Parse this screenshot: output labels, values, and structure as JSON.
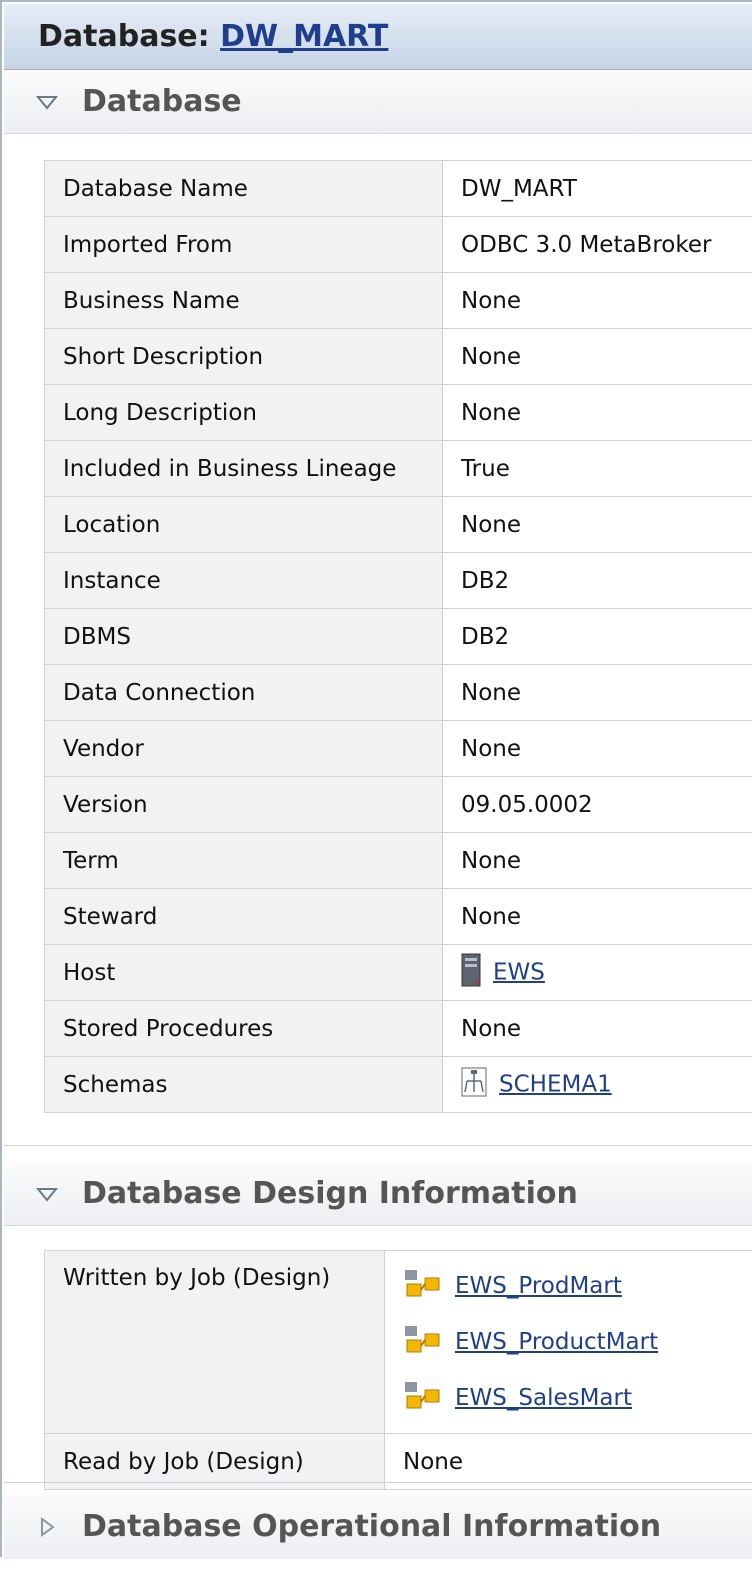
{
  "header": {
    "prefix": "Database:",
    "db_link": "DW_MART"
  },
  "sections": {
    "database": {
      "title": "Database"
    },
    "design": {
      "title": "Database Design Information"
    },
    "operational": {
      "title": "Database Operational Information"
    }
  },
  "db_props": [
    {
      "key": "Database Name",
      "value": "DW_MART"
    },
    {
      "key": "Imported From",
      "value": "ODBC 3.0 MetaBroker"
    },
    {
      "key": "Business Name",
      "value": "None"
    },
    {
      "key": "Short Description",
      "value": "None"
    },
    {
      "key": "Long Description",
      "value": "None"
    },
    {
      "key": "Included in Business Lineage",
      "value": "True"
    },
    {
      "key": "Location",
      "value": "None"
    },
    {
      "key": "Instance",
      "value": "DB2"
    },
    {
      "key": "DBMS",
      "value": "DB2"
    },
    {
      "key": "Data Connection",
      "value": "None"
    },
    {
      "key": "Vendor",
      "value": "None"
    },
    {
      "key": "Version",
      "value": "09.05.0002"
    },
    {
      "key": "Term",
      "value": "None"
    },
    {
      "key": "Steward",
      "value": "None"
    },
    {
      "key": "Host",
      "value": "EWS",
      "icon": "server-icon"
    },
    {
      "key": "Stored Procedures",
      "value": "None"
    },
    {
      "key": "Schemas",
      "value": "SCHEMA1",
      "icon": "schema-icon"
    }
  ],
  "design_props": {
    "written_label": "Written by Job (Design)",
    "written_jobs": [
      "EWS_ProdMart",
      "EWS_ProductMart",
      "EWS_SalesMart"
    ],
    "job_icon": "job-icon",
    "read_label": "Read by Job (Design)",
    "read_value": "None"
  }
}
